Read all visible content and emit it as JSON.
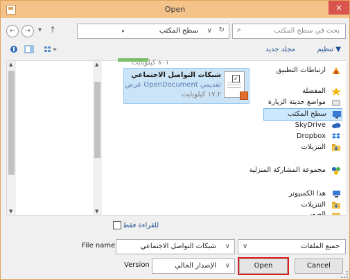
{
  "window": {
    "title": "Open",
    "close_glyph": "×"
  },
  "nav": {
    "back_glyph": "←",
    "forward_glyph": "→",
    "recent_glyph": "▾",
    "up_glyph": "↑",
    "address_arrow": "▸",
    "address_text": "سطح المكتب",
    "address_chevron": "∨",
    "refresh_glyph": "↻",
    "search_placeholder": "بحث في سطح المكتب",
    "search_glyph": "⌕"
  },
  "toolbar": {
    "organize": "تنظيم ▼",
    "new_folder": "مجلد جديد"
  },
  "files": {
    "prev_item_size": "٨٠١ كيلوبايت",
    "selected": {
      "name": "شبكات التواصل الاجتماعي",
      "type": "عرض OpenDocument تقديمي",
      "size": "١٧,٢ كيلوبايت",
      "checked_glyph": "✓"
    }
  },
  "sidebar": {
    "items": [
      {
        "label": "ارتباطات التطبيق",
        "icon": "app-links-icon"
      },
      {
        "label": "المفضلة",
        "icon": "favorites-star-icon"
      },
      {
        "label": "مواضع حديثة الزيارة",
        "icon": "recent-places-icon"
      },
      {
        "label": "سطح المكتب",
        "icon": "desktop-icon",
        "selected": true
      },
      {
        "label": "SkyDrive",
        "icon": "skydrive-cloud-icon"
      },
      {
        "label": "Dropbox",
        "icon": "dropbox-icon"
      },
      {
        "label": "التنزيلات",
        "icon": "downloads-folder-icon"
      },
      {
        "label": "مجموعة المشاركة المنزلية",
        "icon": "homegroup-icon"
      },
      {
        "label": "هذا الكمبيوتر",
        "icon": "computer-icon"
      },
      {
        "label": "التنزيلات",
        "icon": "downloads-folder-icon"
      },
      {
        "label": "الصور",
        "icon": "pictures-folder-icon"
      }
    ],
    "scroll_up": "▲",
    "scroll_down": "▼"
  },
  "bottom": {
    "read_only_label": "للقراءة فقط",
    "file_name_label": "File name:",
    "file_name_value": "شبكات التواصل الاجتماعي",
    "file_type_filter": "جميع الملفات",
    "version_label": "Version",
    "version_value": "الإصدار الحالي",
    "dropdown_glyph": "∨",
    "open_button": "Open",
    "cancel_button": "Cancel"
  },
  "colors": {
    "title_bar": "#f3c38a",
    "close_button": "#d9534f",
    "selection": "#cce4f7",
    "link_blue": "#1e4f91",
    "open_button_highlight": "#e02020"
  }
}
